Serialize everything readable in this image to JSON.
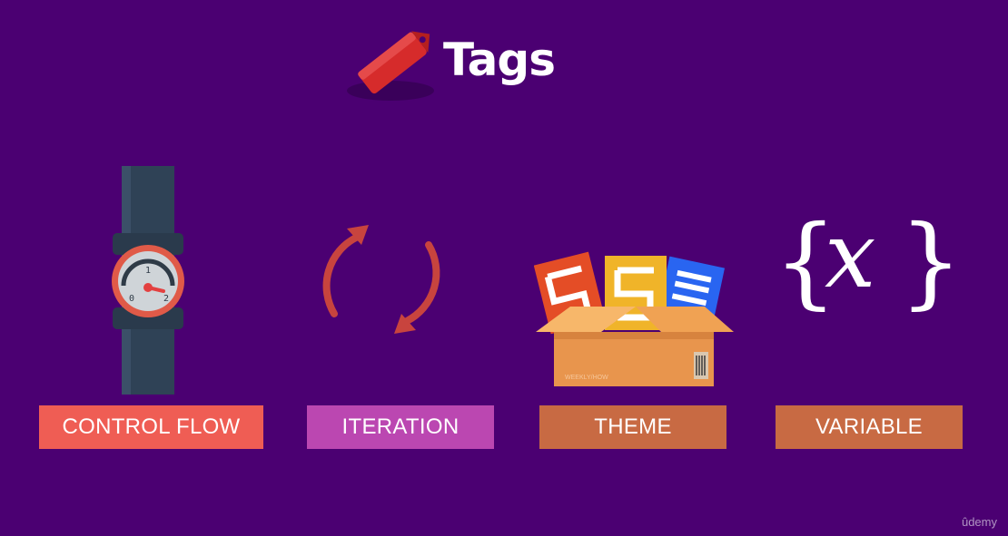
{
  "title": {
    "text": "Tags",
    "icon": "tag-icon"
  },
  "tiles": [
    {
      "label": "CONTROL FLOW",
      "icon": "valve-gauge-icon",
      "color": "#ef5d54"
    },
    {
      "label": "ITERATION",
      "icon": "loop-arrows-icon",
      "color": "#bb47b1"
    },
    {
      "label": "THEME",
      "icon": "box-with-files-icon",
      "color": "#c86a43"
    },
    {
      "label": "VARIABLE",
      "icon": "curly-braces-x-icon",
      "color": "#c86a43"
    }
  ],
  "gauge": {
    "tick_labels": [
      "0",
      "1",
      "2"
    ]
  },
  "variable_icon": {
    "left_brace": "{",
    "symbol": "x",
    "right_brace": "}"
  },
  "box": {
    "brand_text": "WEEKLY/HOW"
  },
  "watermark": "ûdemy",
  "colors": {
    "background": "#4b0072",
    "control_flow": "#ef5d54",
    "iteration": "#bb47b1",
    "theme": "#c86a43",
    "variable": "#c86a43"
  }
}
